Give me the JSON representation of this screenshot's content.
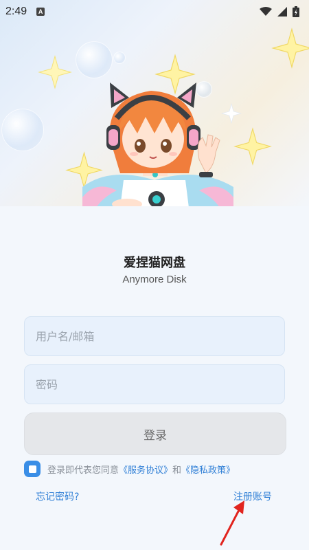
{
  "status_bar": {
    "time": "2:49",
    "notification_icon": "A"
  },
  "app": {
    "name": "爱捏猫网盘",
    "subtitle": "Anymore Disk"
  },
  "form": {
    "username_placeholder": "用户名/邮箱",
    "password_placeholder": "密码",
    "login_label": "登录"
  },
  "agreement": {
    "prefix": "登录即代表您同意",
    "terms": "《服务协议》",
    "and": "和",
    "privacy": "《隐私政策》"
  },
  "links": {
    "forgot": "忘记密码?",
    "register": "注册账号"
  },
  "colors": {
    "accent": "#2f7fd6",
    "checkbox": "#3a8ee6",
    "field_bg": "#e8f1fc"
  },
  "icons": [
    "wifi-icon",
    "signal-icon",
    "battery-icon",
    "mascot-illustration",
    "sparkle-icon",
    "annotation-arrow"
  ]
}
